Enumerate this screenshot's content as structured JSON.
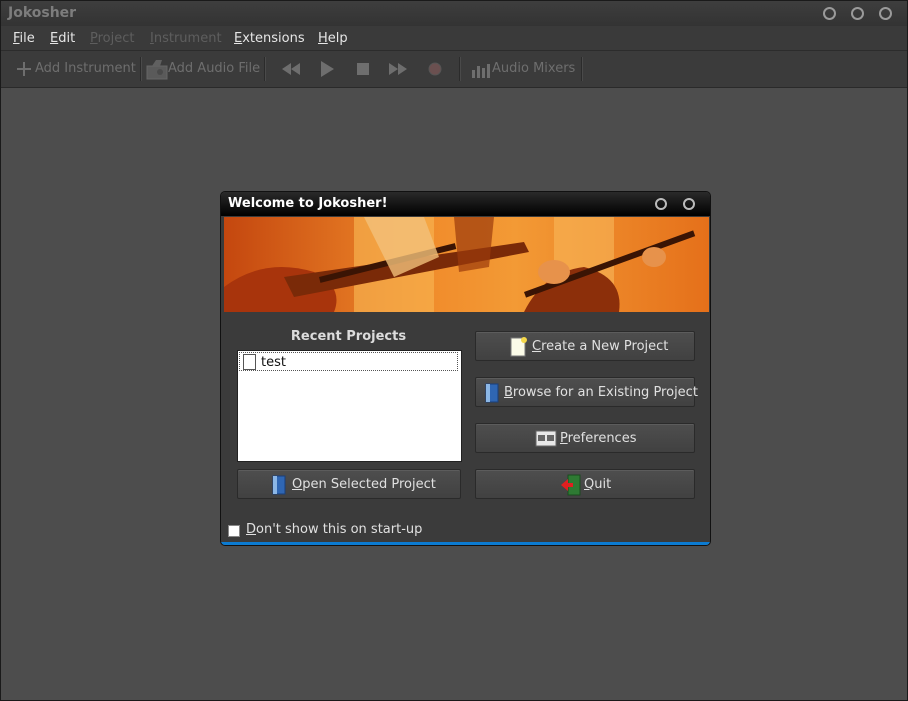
{
  "window": {
    "title": "Jokosher"
  },
  "menu": [
    {
      "key": "F",
      "rest": "ile",
      "enabled": true
    },
    {
      "key": "E",
      "rest": "dit",
      "enabled": true
    },
    {
      "key": "P",
      "rest": "roject",
      "enabled": false
    },
    {
      "key": "I",
      "rest": "nstrument",
      "enabled": false
    },
    {
      "key": "E",
      "rest": "xtensions",
      "enabled": true
    },
    {
      "key": "H",
      "rest": "elp",
      "enabled": true
    }
  ],
  "toolbar": {
    "add_instrument": "Add Instrument",
    "add_audio_file": "Add Audio File",
    "audio_mixers": "Audio Mixers",
    "icons": [
      "plus-icon",
      "audio-file-icon",
      "rewind-icon",
      "play-icon",
      "stop-icon",
      "fast-forward-icon",
      "record-icon",
      "mixer-icon"
    ]
  },
  "dialog": {
    "title": "Welcome to Jokosher!",
    "recent_label": "Recent Projects",
    "recent_projects": [
      "test"
    ],
    "open_selected": {
      "key": "O",
      "rest": "pen Selected Project"
    },
    "create_new": {
      "key": "C",
      "rest": "reate a New Project"
    },
    "browse": {
      "key": "B",
      "rest": "rowse for an Existing Project"
    },
    "preferences": {
      "key": "P",
      "rest": "references"
    },
    "quit": {
      "key": "Q",
      "rest": "uit"
    },
    "dont_show": {
      "key": "D",
      "rest": "on't show this on start-up",
      "checked": false
    }
  },
  "colors": {
    "background": "#4d4d4d",
    "accent": "#0c7bd1",
    "banner": "#e06a10"
  }
}
